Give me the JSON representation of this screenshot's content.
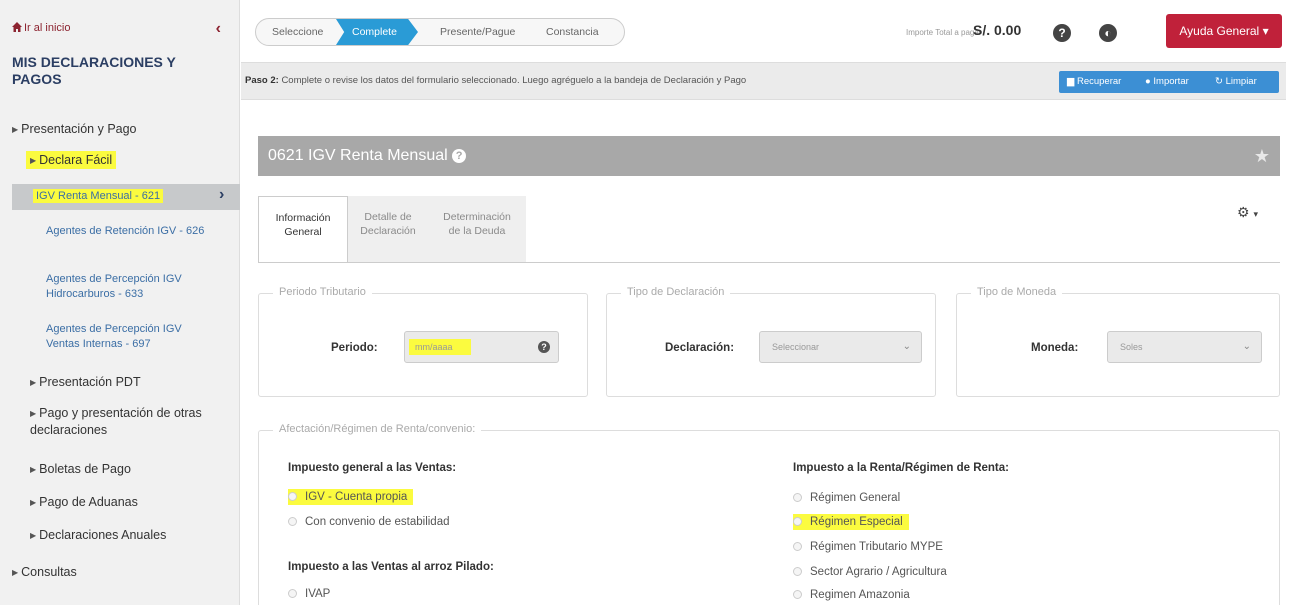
{
  "sidebar": {
    "home_link": "Ir al inicio",
    "title": "MIS DECLARACIONES Y PAGOS",
    "items": [
      {
        "label": "Presentación y Pago"
      },
      {
        "label": "Declara Fácil"
      },
      {
        "label": "IGV Renta Mensual - 621"
      },
      {
        "label": "Agentes de Retención IGV - 626"
      },
      {
        "label": "Agentes de Percepción IGV Hidrocarburos - 633"
      },
      {
        "label": "Agentes de Percepción IGV Ventas Internas - 697"
      },
      {
        "label": "Presentación PDT"
      },
      {
        "label": "Pago y presentación de otras declaraciones"
      },
      {
        "label": "Boletas de Pago"
      },
      {
        "label": "Pago de Aduanas"
      },
      {
        "label": "Declaraciones Anuales"
      },
      {
        "label": "Consultas"
      }
    ]
  },
  "topbar": {
    "steps": [
      "Seleccione",
      "Complete",
      "Presente/Pague",
      "Constancia"
    ],
    "active_step": "Complete",
    "total_label": "Importe Total a pagar",
    "total_value": "S/. 0.00",
    "help_button": "Ayuda General"
  },
  "paso": {
    "bold": "Paso 2:",
    "text": "Complete o revise los datos del formulario seleccionado. Luego agréguelo a la bandeja de Declaración y Pago",
    "actions": [
      "Recuperar",
      "Importar",
      "Limpiar"
    ]
  },
  "form": {
    "title": "0621 IGV Renta Mensual",
    "tabs": [
      {
        "line1": "Información",
        "line2": "General",
        "active": true
      },
      {
        "line1": "Detalle de",
        "line2": "Declaración",
        "active": false
      },
      {
        "line1": "Determinación",
        "line2": "de la Deuda",
        "active": false
      }
    ],
    "periodo_legend": "Periodo Tributario",
    "periodo_label": "Periodo:",
    "periodo_placeholder": "mm/aaaa",
    "tipo_decl_legend": "Tipo de Declaración",
    "tipo_decl_label": "Declaración:",
    "tipo_decl_value": "Seleccionar",
    "moneda_legend": "Tipo de Moneda",
    "moneda_label": "Moneda:",
    "moneda_value": "Soles",
    "regimen_legend": "Afectación/Régimen de Renta/convenio:",
    "igv_head": "Impuesto general a las Ventas:",
    "igv_options": [
      "IGV - Cuenta propia",
      "Con convenio de estabilidad"
    ],
    "ivap_head": "Impuesto a las Ventas al arroz Pilado:",
    "ivap_options": [
      "IVAP"
    ],
    "renta_head": "Impuesto a la Renta/Régimen de Renta:",
    "renta_options": [
      "Régimen General",
      "Régimen Especial",
      "Régimen Tributario MYPE",
      "Sector Agrario / Agricultura",
      "Regimen Amazonia"
    ]
  },
  "colors": {
    "accent": "#2a9bd6",
    "brand_red": "#c0213a",
    "highlight": "#fbfb3f"
  }
}
